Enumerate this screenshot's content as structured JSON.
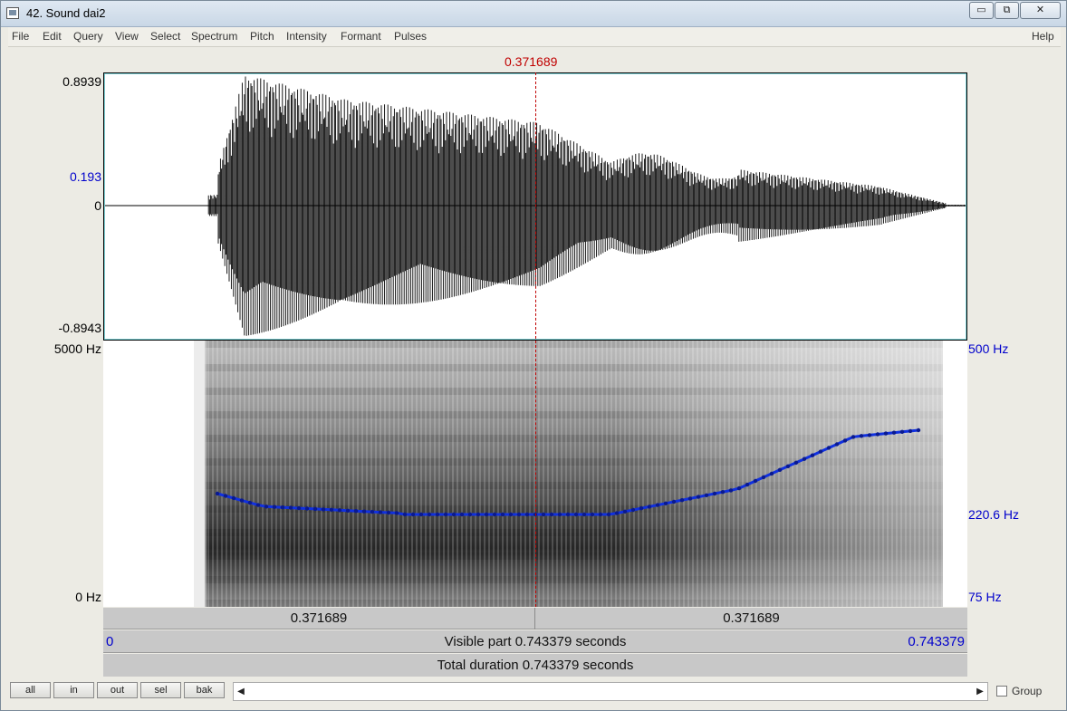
{
  "window": {
    "title": "42. Sound dai2",
    "controls": {
      "minimize": "▭",
      "maximize": "⧉",
      "close": "✕"
    }
  },
  "menu": {
    "items": [
      "File",
      "Edit",
      "Query",
      "View",
      "Select",
      "Spectrum",
      "Pitch",
      "Intensity",
      "Formant",
      "Pulses"
    ],
    "help": "Help"
  },
  "cursor": {
    "time_label": "0.371689",
    "color": "#c00000"
  },
  "waveform": {
    "max_label": "0.8939",
    "mark_label": "0.193",
    "zero_label": "0",
    "min_label": "-0.8943"
  },
  "spectrogram": {
    "top_label": "5000 Hz",
    "bottom_label": "0 Hz",
    "pitch_top_label": "500 Hz",
    "pitch_mid_label": "220.6 Hz",
    "pitch_bottom_label": "75 Hz",
    "pitch_color": "#1030e0"
  },
  "time_bars": {
    "left_segment": "0.371689",
    "right_segment": "0.371689",
    "visible_start": "0",
    "visible_text": "Visible part 0.743379 seconds",
    "visible_end": "0.743379",
    "total_text": "Total duration 0.743379 seconds"
  },
  "bottom": {
    "buttons": [
      "all",
      "in",
      "out",
      "sel",
      "bak"
    ],
    "scroll_left": "◀",
    "scroll_right": "▶",
    "group_label": "Group"
  }
}
